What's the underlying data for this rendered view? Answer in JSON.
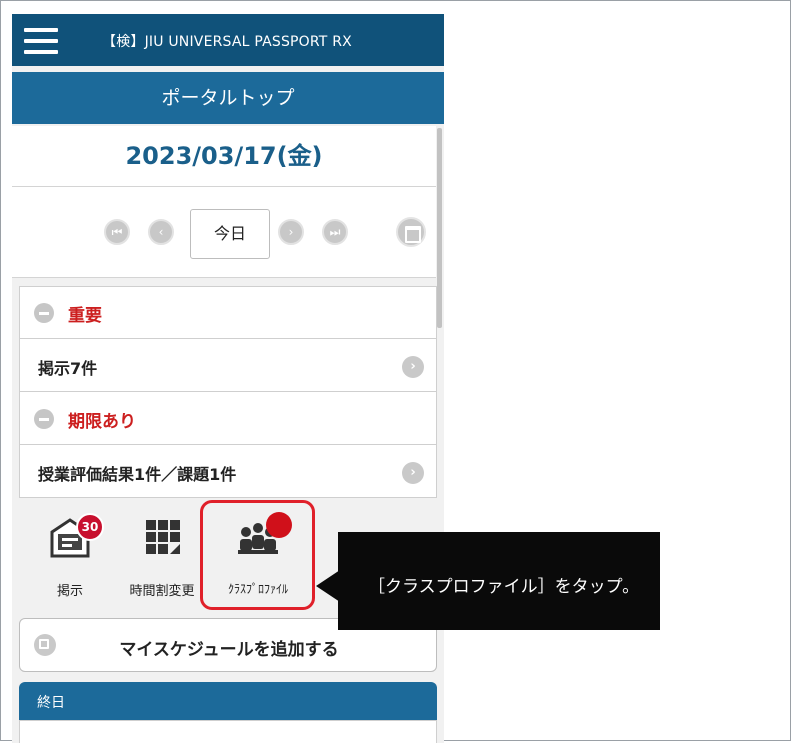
{
  "header": {
    "app_title": "【検】JIU UNIVERSAL PASSPORT RX",
    "menu_icon": "hamburger-icon"
  },
  "page": {
    "title": "ポータルトップ",
    "date": "2023/03/17(金)"
  },
  "date_nav": {
    "today_label": "今日",
    "icons": [
      "first-icon",
      "prev-icon",
      "next-icon",
      "last-icon",
      "calendar-icon"
    ]
  },
  "notices": {
    "important_title": "重要",
    "important_item": "掲示7件",
    "deadline_title": "期限あり",
    "deadline_item": "授業評価結果1件／課題1件"
  },
  "tiles": [
    {
      "label": "掲示",
      "icon": "bulletin-icon",
      "badge": "30"
    },
    {
      "label": "時間割変更",
      "icon": "timetable-icon"
    },
    {
      "label": "ｸﾗｽﾌﾟﾛﾌｧｲﾙ",
      "icon": "class-profile-icon"
    }
  ],
  "add_schedule_label": "マイスケジュールを追加する",
  "all_day_label": "終日",
  "callout_text": "［クラスプロファイル］をタップ。",
  "colors": {
    "header": "#10527a",
    "bar": "#1c6a9a",
    "date": "#1a5f8a",
    "accent_red": "#cc1f1f",
    "highlight": "#e0202a"
  }
}
